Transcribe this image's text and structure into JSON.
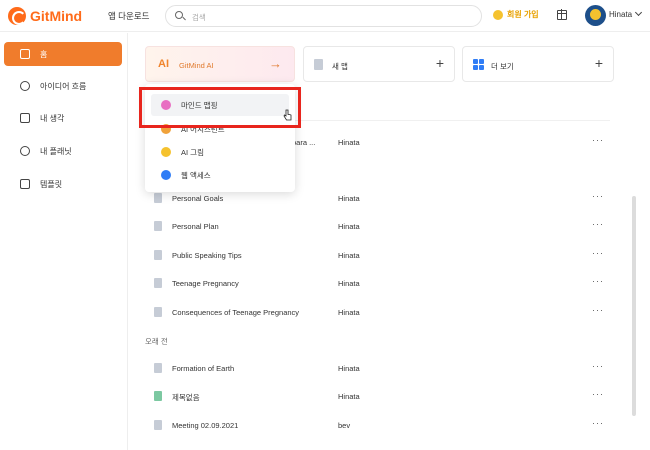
{
  "header": {
    "brand": "GitMind",
    "download": "앱 다운로드",
    "search_placeholder": "검색",
    "member": "회원 가입",
    "username": "Hinata"
  },
  "sidebar": {
    "items": [
      {
        "label": "홈",
        "icon": "home-icon"
      },
      {
        "label": "아이디어 흐름",
        "icon": "bulb-icon"
      },
      {
        "label": "내 생각",
        "icon": "note-icon"
      },
      {
        "label": "내 플래닛",
        "icon": "planet-icon"
      },
      {
        "label": "템플릿",
        "icon": "template-icon"
      }
    ]
  },
  "cards": {
    "ai_badge": "AI",
    "ai_label": "GitMind AI",
    "ai_arrow": "→",
    "new_label": "새 맵",
    "more_label": "더 보기",
    "plus": "+"
  },
  "dropdown": {
    "items": [
      {
        "label": "마인드 맵핑",
        "icon": "sparkle-icon",
        "color": "#e86fc2"
      },
      {
        "label": "AI 어시스턴트",
        "icon": "assistant-icon",
        "color": "#f0a23a"
      },
      {
        "label": "AI 그림",
        "icon": "palette-icon",
        "color": "#f5c22e"
      },
      {
        "label": "웹 액세스",
        "icon": "globe-icon",
        "color": "#2f7df6"
      }
    ]
  },
  "list": {
    "recent": [
      {
        "name": "para ...",
        "owner": "Hinata"
      },
      {
        "name": "Personal Goals",
        "owner": "Hinata"
      },
      {
        "name": "Personal Plan",
        "owner": "Hinata"
      },
      {
        "name": "Public Speaking Tips",
        "owner": "Hinata"
      },
      {
        "name": "Teenage Pregnancy",
        "owner": "Hinata"
      },
      {
        "name": "Consequences of Teenage Pregnancy",
        "owner": "Hinata"
      }
    ],
    "older_section": "오래 전",
    "older": [
      {
        "name": "Formation of Earth",
        "owner": "Hinata"
      },
      {
        "name": "제목없음",
        "owner": "Hinata"
      },
      {
        "name": "Meeting 02.09.2021",
        "owner": "bev"
      }
    ],
    "more": "···"
  },
  "colors": {
    "accent": "#f07c2c",
    "highlight_box": "#e8251d"
  }
}
